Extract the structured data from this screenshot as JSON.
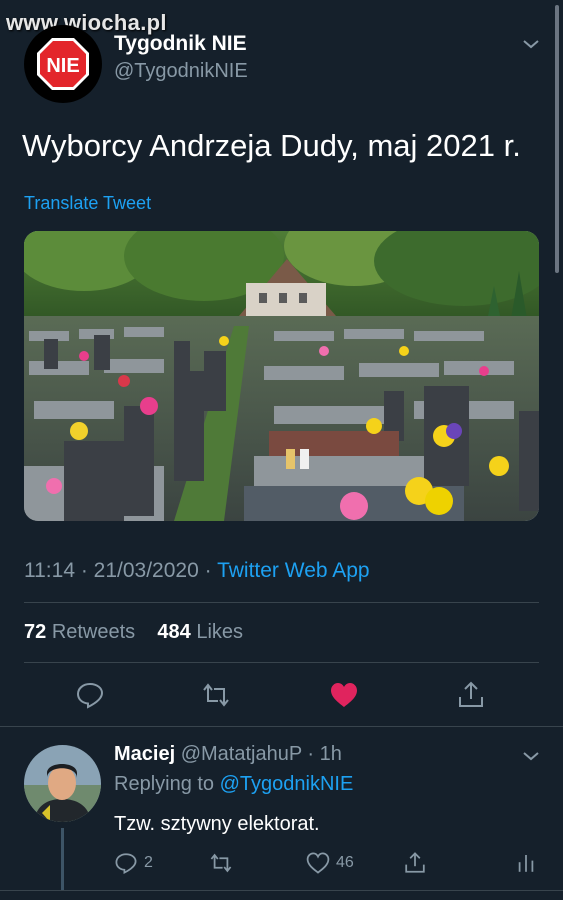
{
  "watermark": "www.wiocha.pl",
  "tweet": {
    "author_name": "Tygodnik NIE",
    "author_handle": "@TygodnikNIE",
    "logo_text": "NIE",
    "text": "Wyborcy Andrzeja Dudy, maj 2021 r.",
    "translate_label": "Translate Tweet",
    "time": "11:14",
    "sep1": " · ",
    "date": "21/03/2020",
    "sep2": " · ",
    "app": "Twitter Web App",
    "retweets_count": "72",
    "retweets_label": "Retweets",
    "likes_count": "484",
    "likes_label": "Likes"
  },
  "reply": {
    "name": "Maciej",
    "handle_time": "@MatatjahuP · 1h",
    "replying_prefix": "Replying to",
    "replying_to": "@TygodnikNIE",
    "text": "Tzw. sztywny elektorat.",
    "reply_count": "2",
    "like_count": "46"
  },
  "colors": {
    "background": "#15202b",
    "accent": "#1da1f2",
    "like": "#e0245e",
    "muted": "#8899a6"
  }
}
